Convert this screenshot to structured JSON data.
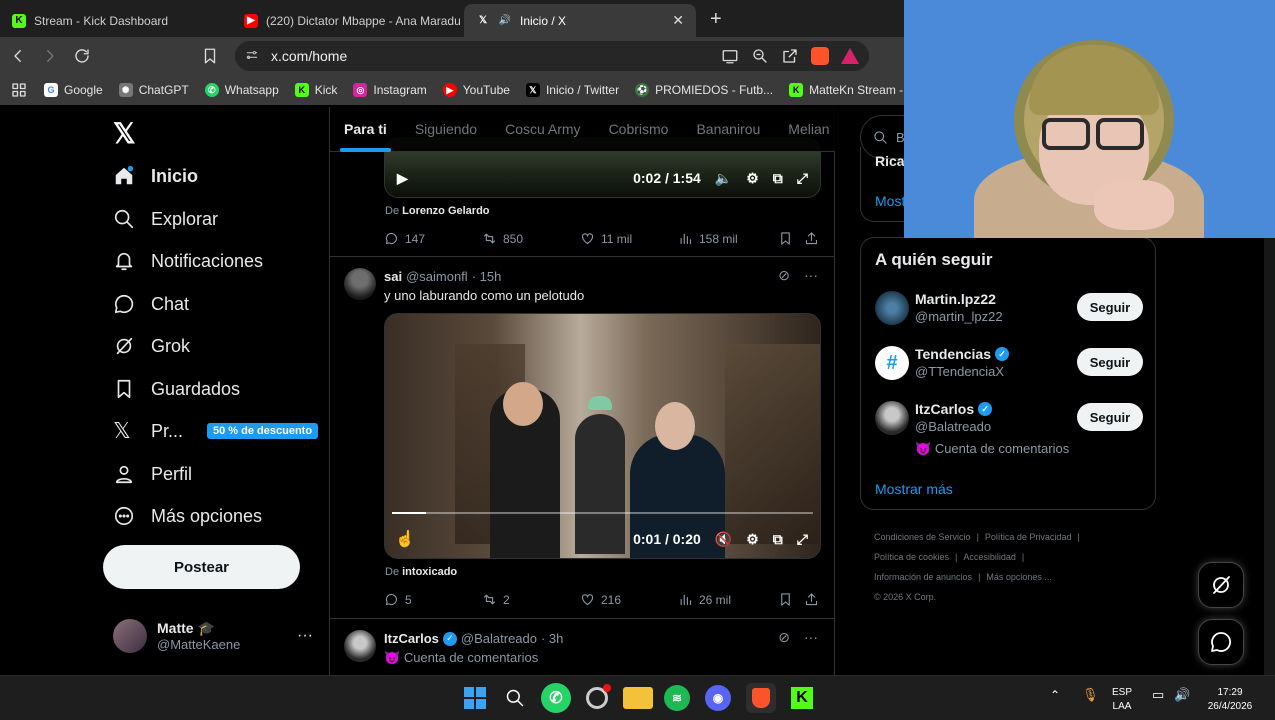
{
  "browser": {
    "tabs": [
      {
        "title": "Stream - Kick Dashboard",
        "icon": "kick-icon",
        "color": "#53fc18",
        "active": false
      },
      {
        "title": "(220) Dictator Mbappe - Ana Maradu",
        "icon": "youtube-icon",
        "color": "#ff0000",
        "active": false
      },
      {
        "title": "Inicio / X",
        "icon": "x-icon",
        "color": "#ffffff",
        "active": true
      }
    ],
    "new_tab": "+",
    "url": "x.com/home",
    "bookmarks": [
      {
        "label": "Google",
        "icon": "google-icon",
        "color": "#4285f4"
      },
      {
        "label": "ChatGPT",
        "icon": "chatgpt-icon",
        "color": "#777777"
      },
      {
        "label": "Whatsapp",
        "icon": "whatsapp-icon",
        "color": "#25d366"
      },
      {
        "label": "Kick",
        "icon": "kick-icon",
        "color": "#53fc18"
      },
      {
        "label": "Instagram",
        "icon": "instagram-icon",
        "color": "#d6249f"
      },
      {
        "label": "YouTube",
        "icon": "youtube-icon",
        "color": "#ff0000"
      },
      {
        "label": "Inicio / Twitter",
        "icon": "x-icon",
        "color": "#000000"
      },
      {
        "label": "PROMIEDOS - Futb...",
        "icon": "promiedos-icon",
        "color": "#2e7d32"
      },
      {
        "label": "MatteKn Stream -...",
        "icon": "kick-icon",
        "color": "#53fc18"
      }
    ]
  },
  "nav": {
    "logo": "𝕏",
    "items": [
      {
        "label": "Inicio",
        "icon": "home-icon"
      },
      {
        "label": "Explorar",
        "icon": "search-icon"
      },
      {
        "label": "Notificaciones",
        "icon": "bell-icon"
      },
      {
        "label": "Chat",
        "icon": "chat-icon"
      },
      {
        "label": "Grok",
        "icon": "grok-icon"
      },
      {
        "label": "Guardados",
        "icon": "bookmark-icon"
      },
      {
        "label": "Pr...",
        "icon": "x-premium-icon"
      },
      {
        "label": "Perfil",
        "icon": "profile-icon"
      },
      {
        "label": "Más opciones",
        "icon": "more-circle-icon"
      }
    ],
    "premium_badge": "50 % de descuento",
    "post_button": "Postear",
    "user": {
      "name": "Matte",
      "handle": "@MatteKaene"
    }
  },
  "feed": {
    "tabs": [
      "Para ti",
      "Siguiendo",
      "Coscu Army",
      "Cobrismo",
      "Bananirou",
      "Melian"
    ],
    "tweet1": {
      "video_time": "0:02 / 1:54",
      "from_prefix": "De",
      "from": "Lorenzo Gelardo",
      "replies": "147",
      "retweets": "850",
      "likes": "11 mil",
      "views": "158 mil"
    },
    "tweet2": {
      "name": "sai",
      "handle": "@saimonfl",
      "time": "· 15h",
      "text": "y uno laburando como un pelotudo",
      "video_time": "0:01 / 0:20",
      "video_progress": 0.08,
      "from_prefix": "De",
      "from": "intoxicado",
      "replies": "5",
      "retweets": "2",
      "likes": "216",
      "views": "26 mil"
    },
    "tweet3": {
      "name": "ItzCarlos",
      "handle": "@Balatreado",
      "time": "· 3h",
      "subtitle": "Cuenta de comentarios"
    }
  },
  "right": {
    "search_placeholder": "Bu",
    "trend_fragment": "Ricar",
    "trend_more": "Mostr",
    "who_title": "A quién seguir",
    "who": [
      {
        "name": "Martin.lpz22",
        "handle": "@martin_lpz22",
        "verified": false,
        "desc": ""
      },
      {
        "name": "Tendencias",
        "handle": "@TTendenciaX",
        "verified": true,
        "desc": ""
      },
      {
        "name": "ItzCarlos",
        "handle": "@Balatreado",
        "verified": true,
        "desc": "Cuenta de comentarios"
      }
    ],
    "follow_label": "Seguir",
    "show_more": "Mostrar más",
    "footer": [
      "Condiciones de Servicio",
      "|",
      "Política de Privacidad",
      "|",
      "Política de cookies",
      "|",
      "Accesibilidad",
      "|",
      "Información de anuncios",
      "|",
      "Más opciones ...",
      "© 2026 X Corp."
    ]
  },
  "taskbar": {
    "lang": "ESP",
    "lang2": "LAA",
    "time": "17:29",
    "date": "26/4/2026"
  }
}
